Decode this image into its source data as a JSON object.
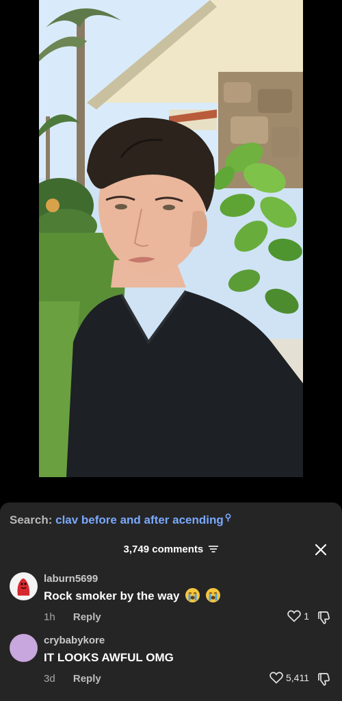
{
  "search": {
    "label": "Search:",
    "query": "clav before and after acending"
  },
  "comments_header": {
    "count_label": "3,749 comments"
  },
  "comments": [
    {
      "username": "laburn5699",
      "text": "Rock smoker by the way",
      "emoji": [
        "loudly-crying-face",
        "loudly-crying-face"
      ],
      "time": "1h",
      "reply_label": "Reply",
      "likes": "1"
    },
    {
      "username": "crybabykore",
      "text": "IT LOOKS AWFUL OMG",
      "time": "3d",
      "reply_label": "Reply",
      "likes": "5,411"
    }
  ],
  "colors": {
    "sheet_bg": "#252525",
    "search_link": "#7aa9ff",
    "avatar2": "#c8a6de"
  }
}
